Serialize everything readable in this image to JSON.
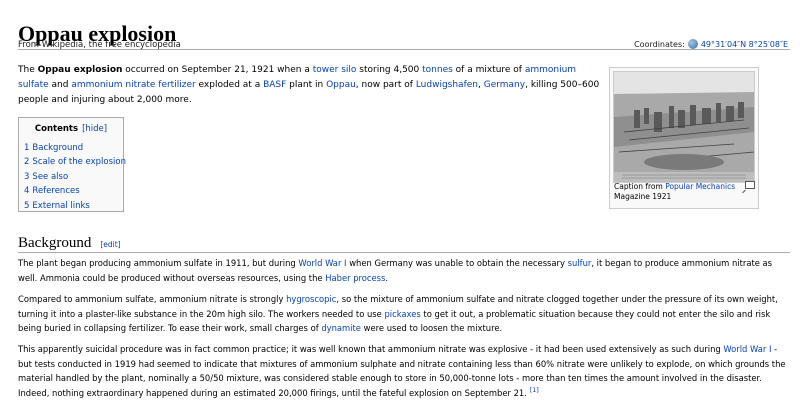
{
  "header": {
    "title": "Oppau explosion",
    "tagline": "From Wikipedia, the free encyclopedia",
    "coordinates_label": "Coordinates:",
    "coordinates_value": "49°31′04″N 8°25′08″E"
  },
  "intro": {
    "t1": "The ",
    "bold": "Oppau explosion",
    "t2": " occurred on September 21, 1921 when a ",
    "l_tower_silo": "tower silo",
    "t3": " storing 4,500 ",
    "l_tonnes": "tonnes",
    "t4": " of a mixture of ",
    "l_ammonium_sulfate": "ammonium sulfate",
    "t5": " and ",
    "l_ammonium_nitrate": "ammonium nitrate fertilizer",
    "t6": " exploded at a ",
    "l_basf": "BASF",
    "t7": " plant in ",
    "l_oppau": "Oppau",
    "t8": ", now part of ",
    "l_ludwigshafen": "Ludwigshafen",
    "t9": ", ",
    "l_germany": "Germany",
    "t10": ", killing 500–600 people and injuring about 2,000 more."
  },
  "toc": {
    "title": "Contents",
    "hide": "[hide]",
    "items": [
      {
        "num": "1",
        "label": "Background"
      },
      {
        "num": "2",
        "label": "Scale of the explosion"
      },
      {
        "num": "3",
        "label": "See also"
      },
      {
        "num": "4",
        "label": "References"
      },
      {
        "num": "5",
        "label": "External links"
      }
    ]
  },
  "thumb": {
    "caption_t1": "Caption from ",
    "caption_link": "Popular Mechanics",
    "caption_t2": " Magazine 1921"
  },
  "background": {
    "heading": "Background",
    "edit": "[edit]",
    "p1": {
      "t1": "The plant began producing ammonium sulfate in 1911, but during ",
      "l_ww1": "World War I",
      "t2": " when Germany was unable to obtain the necessary ",
      "l_sulfur": "sulfur",
      "t3": ", it began to produce ammonium nitrate as well. Ammonia could be produced without overseas resources, using the ",
      "l_haber": "Haber process",
      "t4": "."
    },
    "p2": {
      "t1": "Compared to ammonium sulfate, ammonium nitrate is strongly ",
      "l_hygroscopic": "hygroscopic",
      "t2": ", so the mixture of ammonium sulfate and nitrate clogged together under the pressure of its own weight, turning it into a plaster-like substance in the 20m high silo. The workers needed to use ",
      "l_pickaxes": "pickaxes",
      "t3": " to get it out, a problematic situation because they could not enter the silo and risk being buried in collapsing fertilizer. To ease their work, small charges of ",
      "l_dynamite": "dynamite",
      "t4": " were used to loosen the mixture."
    },
    "p3": {
      "t1": "This apparently suicidal procedure was in fact common practice; it was well known that ammonium nitrate was explosive - it had been used extensively as such during ",
      "l_ww1": "World War I",
      "t2": " - but tests conducted in 1919 had seemed to indicate that mixtures of ammonium sulphate and nitrate containing less than 60% nitrate were unlikely to explode, on which grounds the material handled by the plant, nominally a 50/50 mixture, was considered stable enough to store in 50,000-tonne lots - more than ten times the amount involved in the disaster. Indeed, nothing extraordinary happened during an estimated 20,000 firings, until the fateful explosion on September 21. ",
      "ref": "[1]"
    }
  }
}
